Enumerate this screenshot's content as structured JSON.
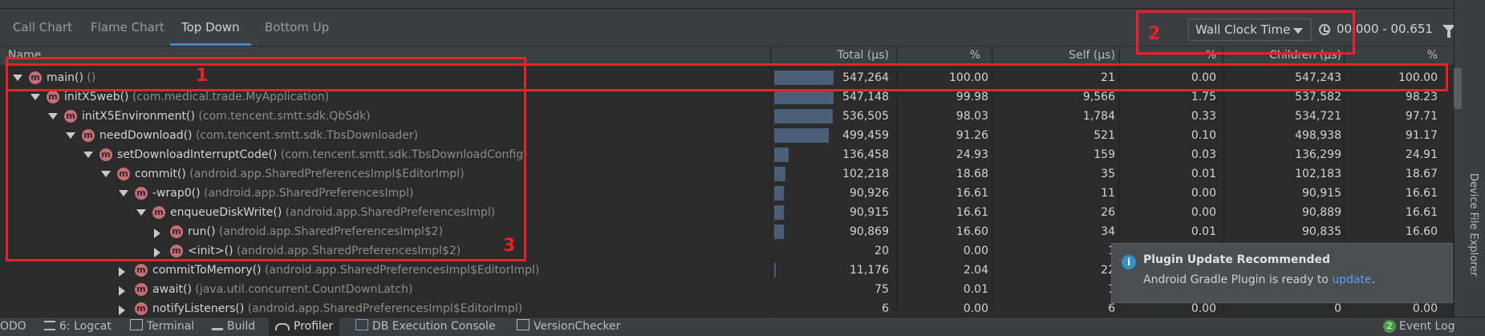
{
  "tabs": [
    "Call Chart",
    "Flame Chart",
    "Top Down",
    "Bottom Up"
  ],
  "active_tab": "Top Down",
  "toolbar": {
    "clock_select_value": "Wall Clock Time",
    "time_range": "00.000 - 00.651"
  },
  "columns": {
    "name": "Name",
    "total": "Total (μs)",
    "total_pct": "%",
    "self": "Self (μs)",
    "self_pct": "%",
    "children": "Children (μs)",
    "children_pct": "%"
  },
  "rows": [
    {
      "expanded": true,
      "name": "main()",
      "cls": "()",
      "total": "547,264",
      "total_pct": "100.00",
      "self": "21",
      "self_pct": "0.00",
      "children": "547,243",
      "children_pct": "100.00",
      "bar": 1.0
    },
    {
      "expanded": true,
      "name": "initX5web()",
      "cls": "(com.medical.trade.MyApplication)",
      "total": "547,148",
      "total_pct": "99.98",
      "self": "9,566",
      "self_pct": "1.75",
      "children": "537,582",
      "children_pct": "98.23",
      "bar": 0.9998
    },
    {
      "expanded": true,
      "name": "initX5Environment()",
      "cls": "(com.tencent.smtt.sdk.QbSdk)",
      "total": "536,505",
      "total_pct": "98.03",
      "self": "1,784",
      "self_pct": "0.33",
      "children": "534,721",
      "children_pct": "97.71",
      "bar": 0.9803
    },
    {
      "expanded": true,
      "name": "needDownload()",
      "cls": "(com.tencent.smtt.sdk.TbsDownloader)",
      "total": "499,459",
      "total_pct": "91.26",
      "self": "521",
      "self_pct": "0.10",
      "children": "498,938",
      "children_pct": "91.17",
      "bar": 0.9126
    },
    {
      "expanded": true,
      "name": "setDownloadInterruptCode()",
      "cls": "(com.tencent.smtt.sdk.TbsDownloadConfig)",
      "total": "136,458",
      "total_pct": "24.93",
      "self": "159",
      "self_pct": "0.03",
      "children": "136,299",
      "children_pct": "24.91",
      "bar": 0.2493
    },
    {
      "expanded": true,
      "name": "commit()",
      "cls": "(android.app.SharedPreferencesImpl$EditorImpl)",
      "total": "102,218",
      "total_pct": "18.68",
      "self": "35",
      "self_pct": "0.01",
      "children": "102,183",
      "children_pct": "18.67",
      "bar": 0.1868
    },
    {
      "expanded": true,
      "name": "-wrap0()",
      "cls": "(android.app.SharedPreferencesImpl)",
      "total": "90,926",
      "total_pct": "16.61",
      "self": "11",
      "self_pct": "0.00",
      "children": "90,915",
      "children_pct": "16.61",
      "bar": 0.1661
    },
    {
      "expanded": true,
      "name": "enqueueDiskWrite()",
      "cls": "(android.app.SharedPreferencesImpl)",
      "total": "90,915",
      "total_pct": "16.61",
      "self": "26",
      "self_pct": "0.00",
      "children": "90,889",
      "children_pct": "16.61",
      "bar": 0.1661
    },
    {
      "expanded": false,
      "name": "run()",
      "cls": "(android.app.SharedPreferencesImpl$2)",
      "total": "90,869",
      "total_pct": "16.60",
      "self": "34",
      "self_pct": "0.01",
      "children": "90,835",
      "children_pct": "16.60",
      "bar": 0.166
    },
    {
      "expanded": false,
      "name": "<init>()",
      "cls": "(android.app.SharedPreferencesImpl$2)",
      "total": "20",
      "total_pct": "0.00",
      "self": "1",
      "self_pct": "",
      "children": "",
      "children_pct": "",
      "bar": 0.0
    },
    {
      "expanded": false,
      "name": "commitToMemory()",
      "cls": "(android.app.SharedPreferencesImpl$EditorImpl)",
      "total": "11,176",
      "total_pct": "2.04",
      "self": "22",
      "self_pct": "",
      "children": "",
      "children_pct": "",
      "bar": 0.0204
    },
    {
      "expanded": false,
      "name": "await()",
      "cls": "(java.util.concurrent.CountDownLatch)",
      "total": "75",
      "total_pct": "0.01",
      "self": "1",
      "self_pct": "",
      "children": "",
      "children_pct": "",
      "bar": 0.0
    },
    {
      "expanded": false,
      "name": "notifyListeners()",
      "cls": "(android.app.SharedPreferencesImpl$EditorImpl)",
      "total": "6",
      "total_pct": "0.00",
      "self": "6",
      "self_pct": "0.00",
      "children": "0",
      "children_pct": "0.00",
      "bar": 0.0
    }
  ],
  "notification": {
    "title": "Plugin Update Recommended",
    "body_prefix": "Android Gradle Plugin is ready to ",
    "link": "update",
    "body_suffix": "."
  },
  "side_panel": {
    "label": "Device File Explorer"
  },
  "statusbar": {
    "todo": "ODO",
    "logcat": "6: Logcat",
    "terminal": "Terminal",
    "build": "Build",
    "profiler": "Profiler",
    "db_console": "DB Execution Console",
    "version_checker": "VersionChecker",
    "event_log_count": "2",
    "event_log": "Event Log"
  },
  "annotations": [
    "1",
    "2",
    "3"
  ],
  "colors": {
    "annotation": "#e8212b",
    "accent": "#4a88c7",
    "method_icon": "#c86c75",
    "link": "#589df6"
  }
}
